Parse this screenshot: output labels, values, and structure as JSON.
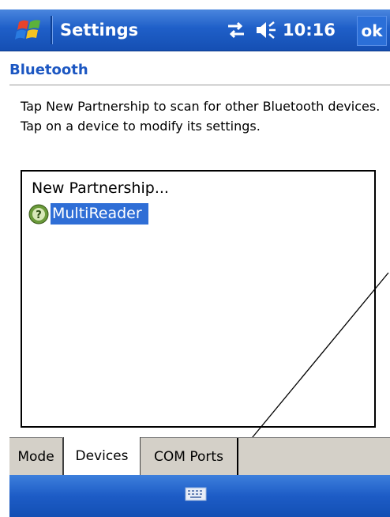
{
  "titlebar": {
    "title": "Settings",
    "time": "10:16",
    "ok_label": "ok",
    "icons": [
      "windows-start-icon",
      "connectivity-icon",
      "speaker-icon"
    ]
  },
  "section": {
    "header": "Bluetooth"
  },
  "instructions": "Tap New Partnership to scan for other Bluetooth devices. Tap on a device to modify its settings.",
  "device_list": {
    "items": [
      {
        "label": "New Partnership...",
        "selected": false
      },
      {
        "label": "MultiReader",
        "selected": true,
        "icon": "unknown-device-icon"
      }
    ]
  },
  "tabs": [
    {
      "label": "Mode",
      "active": false
    },
    {
      "label": "Devices",
      "active": true
    },
    {
      "label": "COM Ports",
      "active": false
    }
  ],
  "bottombar": {
    "icon": "keyboard-icon"
  },
  "colors": {
    "titlebar": "#1f5fc8",
    "header_text": "#1c57c2",
    "selection": "#2f6ed6",
    "tab_bg": "#d4d0c8"
  }
}
